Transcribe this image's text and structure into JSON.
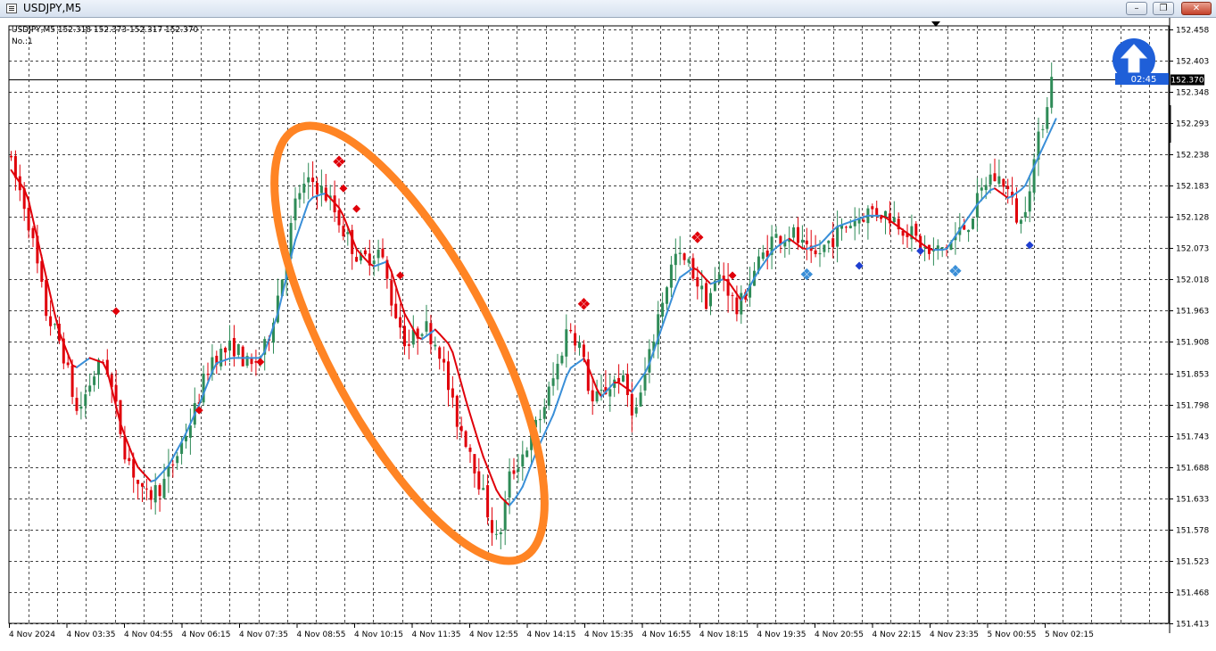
{
  "window": {
    "title": "USDJPY,M5",
    "minimize_label": "–",
    "restore_label": "❐",
    "close_label": "✕"
  },
  "header": {
    "info": "USDJPY,M5  152.318 152.373 152.317 152.370",
    "subwindow": "No.:1"
  },
  "timer": "02:45",
  "colors": {
    "bull": "#2e8b57",
    "bear": "#e0000a",
    "ma_down": "#e0000a",
    "ma_up": "#3a8fd8",
    "ellipse": "#ff8424",
    "badge": "#1f5fd8"
  },
  "chart_data": {
    "type": "candlestick",
    "symbol": "USDJPY",
    "timeframe": "M5",
    "bid": 152.37,
    "ylim": [
      151.413,
      152.483
    ],
    "yticks": [
      152.458,
      152.403,
      152.348,
      152.293,
      152.238,
      152.183,
      152.128,
      152.073,
      152.018,
      151.963,
      151.908,
      151.853,
      151.798,
      151.743,
      151.688,
      151.633,
      151.578,
      151.523,
      151.468,
      151.413
    ],
    "xticks": [
      "4 Nov 2024",
      "4 Nov 03:35",
      "4 Nov 04:55",
      "4 Nov 06:15",
      "4 Nov 07:35",
      "4 Nov 08:55",
      "4 Nov 10:15",
      "4 Nov 11:35",
      "4 Nov 12:55",
      "4 Nov 14:15",
      "4 Nov 15:35",
      "4 Nov 16:55",
      "4 Nov 18:15",
      "4 Nov 19:35",
      "4 Nov 20:55",
      "4 Nov 22:15",
      "4 Nov 23:35",
      "5 Nov 00:55",
      "5 Nov 02:15"
    ],
    "bars": 240,
    "path_anchors": [
      [
        0,
        152.24
      ],
      [
        5,
        152.14
      ],
      [
        10,
        151.96
      ],
      [
        14,
        151.9
      ],
      [
        18,
        151.78
      ],
      [
        22,
        151.85
      ],
      [
        25,
        151.88
      ],
      [
        30,
        151.72
      ],
      [
        35,
        151.63
      ],
      [
        40,
        151.66
      ],
      [
        44,
        151.72
      ],
      [
        48,
        151.79
      ],
      [
        52,
        151.88
      ],
      [
        58,
        151.9
      ],
      [
        62,
        151.86
      ],
      [
        66,
        151.9
      ],
      [
        70,
        152.02
      ],
      [
        74,
        152.17
      ],
      [
        78,
        152.19
      ],
      [
        82,
        152.16
      ],
      [
        86,
        152.1
      ],
      [
        90,
        152.05
      ],
      [
        95,
        152.07
      ],
      [
        98,
        151.98
      ],
      [
        102,
        151.9
      ],
      [
        106,
        151.94
      ],
      [
        110,
        151.9
      ],
      [
        114,
        151.78
      ],
      [
        118,
        151.72
      ],
      [
        122,
        151.62
      ],
      [
        125,
        151.55
      ],
      [
        128,
        151.67
      ],
      [
        132,
        151.72
      ],
      [
        136,
        151.78
      ],
      [
        140,
        151.86
      ],
      [
        143,
        151.94
      ],
      [
        146,
        151.9
      ],
      [
        149,
        151.8
      ],
      [
        152,
        151.82
      ],
      [
        156,
        151.85
      ],
      [
        160,
        151.78
      ],
      [
        163,
        151.86
      ],
      [
        166,
        151.96
      ],
      [
        170,
        152.06
      ],
      [
        174,
        152.04
      ],
      [
        178,
        151.98
      ],
      [
        182,
        152.03
      ],
      [
        186,
        151.96
      ],
      [
        190,
        152.03
      ],
      [
        195,
        152.09
      ],
      [
        200,
        152.1
      ],
      [
        205,
        152.05
      ],
      [
        210,
        152.09
      ],
      [
        215,
        152.12
      ],
      [
        220,
        152.14
      ],
      [
        225,
        152.13
      ],
      [
        230,
        152.1
      ],
      [
        235,
        152.06
      ],
      [
        240,
        152.08
      ],
      [
        245,
        152.12
      ],
      [
        250,
        152.2
      ],
      [
        254,
        152.19
      ],
      [
        258,
        152.11
      ],
      [
        262,
        152.24
      ],
      [
        266,
        152.37
      ]
    ],
    "ma_anchors": [
      [
        0,
        152.21
      ],
      [
        4,
        152.17
      ],
      [
        8,
        152.05
      ],
      [
        12,
        151.93
      ],
      [
        16,
        151.86
      ],
      [
        20,
        151.88
      ],
      [
        24,
        151.87
      ],
      [
        28,
        151.76
      ],
      [
        32,
        151.69
      ],
      [
        36,
        151.66
      ],
      [
        40,
        151.69
      ],
      [
        44,
        151.74
      ],
      [
        48,
        151.8
      ],
      [
        52,
        151.87
      ],
      [
        56,
        151.88
      ],
      [
        60,
        151.88
      ],
      [
        64,
        151.88
      ],
      [
        68,
        151.96
      ],
      [
        72,
        152.08
      ],
      [
        76,
        152.16
      ],
      [
        80,
        152.17
      ],
      [
        84,
        152.14
      ],
      [
        88,
        152.07
      ],
      [
        92,
        152.04
      ],
      [
        96,
        152.05
      ],
      [
        100,
        151.96
      ],
      [
        104,
        151.91
      ],
      [
        108,
        151.93
      ],
      [
        112,
        151.9
      ],
      [
        116,
        151.8
      ],
      [
        120,
        151.71
      ],
      [
        124,
        151.64
      ],
      [
        127,
        151.62
      ],
      [
        130,
        151.65
      ],
      [
        134,
        151.72
      ],
      [
        138,
        151.78
      ],
      [
        142,
        151.86
      ],
      [
        146,
        151.88
      ],
      [
        150,
        151.81
      ],
      [
        154,
        151.84
      ],
      [
        158,
        151.82
      ],
      [
        162,
        151.86
      ],
      [
        166,
        151.94
      ],
      [
        170,
        152.02
      ],
      [
        174,
        152.04
      ],
      [
        178,
        152.01
      ],
      [
        182,
        152.02
      ],
      [
        186,
        151.98
      ],
      [
        190,
        152.03
      ],
      [
        194,
        152.07
      ],
      [
        198,
        152.09
      ],
      [
        202,
        152.07
      ],
      [
        206,
        152.08
      ],
      [
        210,
        152.11
      ],
      [
        214,
        152.12
      ],
      [
        218,
        152.13
      ],
      [
        222,
        152.13
      ],
      [
        226,
        152.11
      ],
      [
        230,
        152.09
      ],
      [
        234,
        152.07
      ],
      [
        238,
        152.07
      ],
      [
        242,
        152.11
      ],
      [
        246,
        152.15
      ],
      [
        250,
        152.18
      ],
      [
        254,
        152.16
      ],
      [
        258,
        152.18
      ],
      [
        262,
        152.24
      ],
      [
        266,
        152.3
      ]
    ],
    "markers": [
      {
        "bar": 27,
        "price": 151.962,
        "color": "#e0000a",
        "style": "single"
      },
      {
        "bar": 48,
        "price": 151.788,
        "color": "#e0000a",
        "style": "single"
      },
      {
        "bar": 63,
        "price": 151.873,
        "color": "#e0000a",
        "style": "single"
      },
      {
        "bar": 83,
        "price": 152.225,
        "color": "#e0000a",
        "style": "cluster"
      },
      {
        "bar": 85,
        "price": 152.178,
        "color": "#e0000a",
        "style": "single"
      },
      {
        "bar": 88,
        "price": 152.142,
        "color": "#e0000a",
        "style": "single"
      },
      {
        "bar": 99,
        "price": 152.025,
        "color": "#e0000a",
        "style": "single"
      },
      {
        "bar": 146,
        "price": 151.975,
        "color": "#e0000a",
        "style": "cluster"
      },
      {
        "bar": 175,
        "price": 152.092,
        "color": "#e0000a",
        "style": "cluster"
      },
      {
        "bar": 184,
        "price": 152.025,
        "color": "#e0000a",
        "style": "single"
      },
      {
        "bar": 203,
        "price": 152.027,
        "color": "#3a8fd8",
        "style": "cluster"
      },
      {
        "bar": 216,
        "price": 152.042,
        "color": "#1f3fd0",
        "style": "single"
      },
      {
        "bar": 231,
        "price": 152.068,
        "color": "#1f3fd0",
        "style": "single"
      },
      {
        "bar": 240,
        "price": 152.033,
        "color": "#3a8fd8",
        "style": "cluster"
      },
      {
        "bar": 259,
        "price": 152.078,
        "color": "#1f3fd0",
        "style": "single"
      }
    ],
    "ellipse": {
      "label": ""
    },
    "grid": true
  }
}
